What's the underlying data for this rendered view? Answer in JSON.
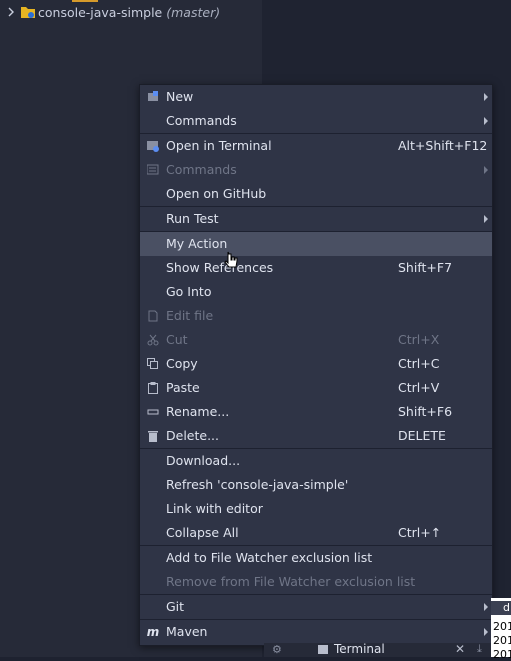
{
  "tree": {
    "project_name": "console-java-simple",
    "branch": "(master)"
  },
  "menu": {
    "items": [
      {
        "label": "New",
        "shortcut": "",
        "submenu": true,
        "disabled": false,
        "icon": "new-icon"
      },
      {
        "label": "Commands",
        "shortcut": "",
        "submenu": true,
        "disabled": false,
        "icon": ""
      },
      {
        "label": "Open in Terminal",
        "shortcut": "Alt+Shift+F12",
        "submenu": false,
        "disabled": false,
        "icon": "terminal-icon"
      },
      {
        "label": "Commands",
        "shortcut": "",
        "submenu": true,
        "disabled": true,
        "icon": "commands-icon"
      },
      {
        "label": "Open on GitHub",
        "shortcut": "",
        "submenu": false,
        "disabled": false,
        "icon": ""
      },
      {
        "label": "Run Test",
        "shortcut": "",
        "submenu": true,
        "disabled": false,
        "icon": ""
      },
      {
        "label": "My Action",
        "shortcut": "",
        "submenu": false,
        "disabled": false,
        "selected": true,
        "icon": ""
      },
      {
        "label": "Show References",
        "shortcut": "Shift+F7",
        "submenu": false,
        "disabled": false,
        "icon": ""
      },
      {
        "label": "Go Into",
        "shortcut": "",
        "submenu": false,
        "disabled": false,
        "icon": ""
      },
      {
        "label": "Edit file",
        "shortcut": "",
        "submenu": false,
        "disabled": true,
        "icon": "edit-file-icon"
      },
      {
        "label": "Cut",
        "shortcut": "Ctrl+X",
        "submenu": false,
        "disabled": true,
        "icon": "cut-icon"
      },
      {
        "label": "Copy",
        "shortcut": "Ctrl+C",
        "submenu": false,
        "disabled": false,
        "icon": "copy-icon"
      },
      {
        "label": "Paste",
        "shortcut": "Ctrl+V",
        "submenu": false,
        "disabled": false,
        "icon": "paste-icon"
      },
      {
        "label": "Rename...",
        "shortcut": "Shift+F6",
        "submenu": false,
        "disabled": false,
        "icon": "rename-icon"
      },
      {
        "label": "Delete...",
        "shortcut": "DELETE",
        "submenu": false,
        "disabled": false,
        "icon": "delete-icon"
      },
      {
        "label": "Download...",
        "shortcut": "",
        "submenu": false,
        "disabled": false,
        "icon": ""
      },
      {
        "label": "Refresh 'console-java-simple'",
        "shortcut": "",
        "submenu": false,
        "disabled": false,
        "icon": ""
      },
      {
        "label": "Link with editor",
        "shortcut": "",
        "submenu": false,
        "disabled": false,
        "icon": ""
      },
      {
        "label": "Collapse All",
        "shortcut": "Ctrl+↑",
        "submenu": false,
        "disabled": false,
        "icon": ""
      },
      {
        "label": "Add to File Watcher exclusion list",
        "shortcut": "",
        "submenu": false,
        "disabled": false,
        "icon": ""
      },
      {
        "label": "Remove from File Watcher exclusion list",
        "shortcut": "",
        "submenu": false,
        "disabled": true,
        "icon": ""
      },
      {
        "label": "Git",
        "shortcut": "",
        "submenu": true,
        "disabled": false,
        "icon": ""
      },
      {
        "label": "Maven",
        "shortcut": "",
        "submenu": true,
        "disabled": false,
        "icon": "maven-icon"
      }
    ]
  },
  "terminal": {
    "label": "Terminal",
    "right_chip": "d",
    "lines": [
      "201",
      "201",
      "201"
    ]
  },
  "colors": {
    "accent_folder": "#e6b422",
    "selection": "#4a5063",
    "menu_bg": "#2f3446"
  }
}
